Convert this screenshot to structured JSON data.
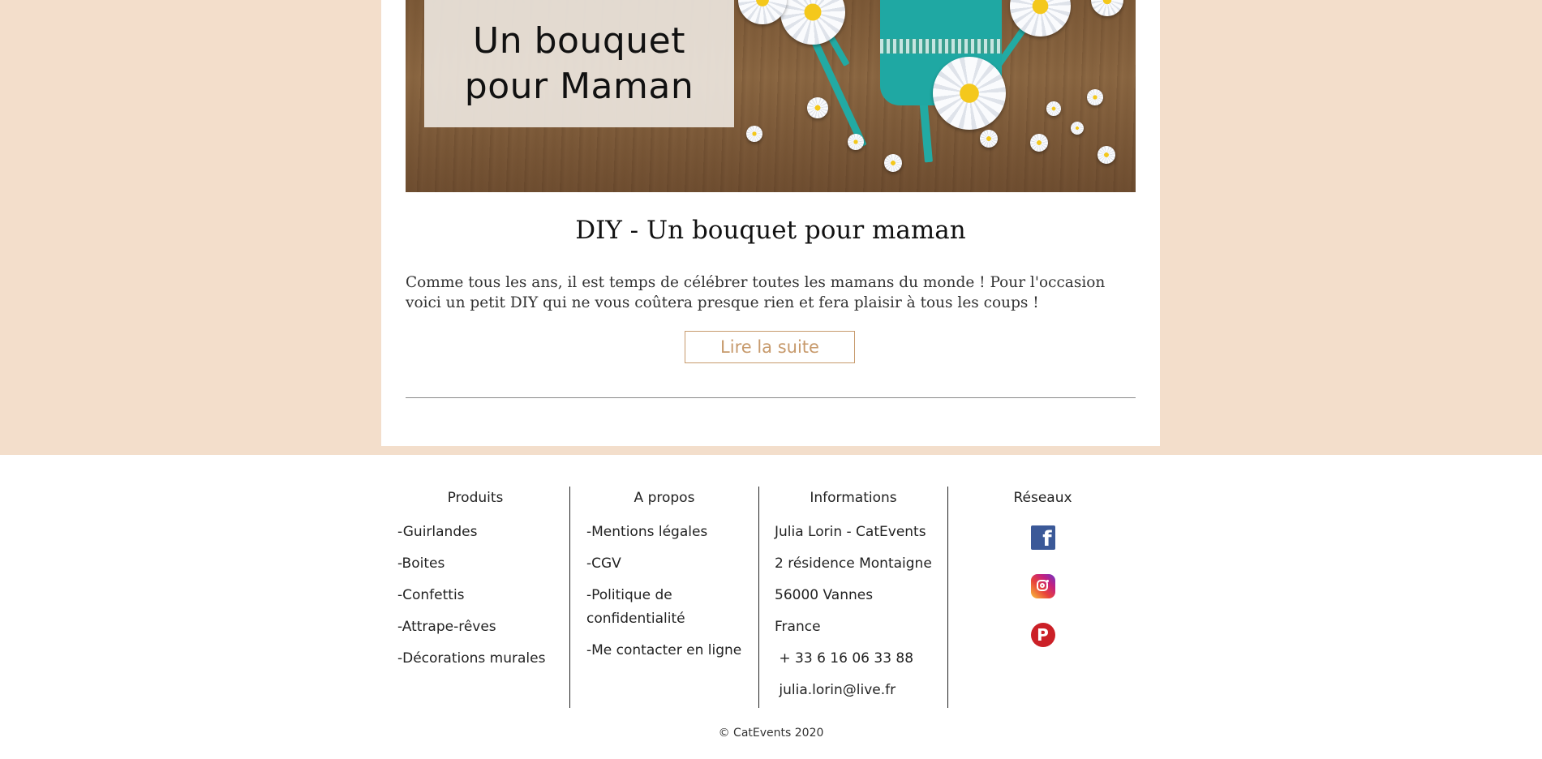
{
  "hero": {
    "image_title_line1": "Un bouquet",
    "image_title_line2": "pour Maman"
  },
  "post": {
    "title": "DIY - Un bouquet pour maman",
    "excerpt": "Comme tous les ans, il est temps de célébrer toutes les mamans du monde ! Pour l'occasion voici un petit DIY qui ne vous coûtera presque rien et fera plaisir à tous les coups !",
    "read_more_label": "Lire la suite"
  },
  "footer": {
    "produits": {
      "heading": "Produits",
      "items": [
        "-Guirlandes",
        "-Boites",
        "-Confettis",
        "-Attrape-rêves",
        "-Décorations murales"
      ]
    },
    "apropos": {
      "heading": "A propos",
      "items": [
        "-Mentions légales",
        "-CGV",
        "-Politique de confidentialité",
        "-Me contacter en ligne"
      ]
    },
    "informations": {
      "heading": "Informations",
      "items": [
        "Julia Lorin - CatEvents",
        "2 résidence Montaigne",
        "56000 Vannes",
        "France",
        " + 33 6 16 06 33 88",
        " julia.lorin@live.fr"
      ]
    },
    "reseaux": {
      "heading": "Réseaux",
      "icons": [
        "facebook-icon",
        "instagram-icon",
        "pinterest-icon"
      ]
    },
    "copyright": "© CatEvents 2020"
  },
  "colors": {
    "page_band": "#f3decb",
    "accent": "#c79a6c",
    "facebook": "#3b5998",
    "pinterest": "#cb2027"
  }
}
